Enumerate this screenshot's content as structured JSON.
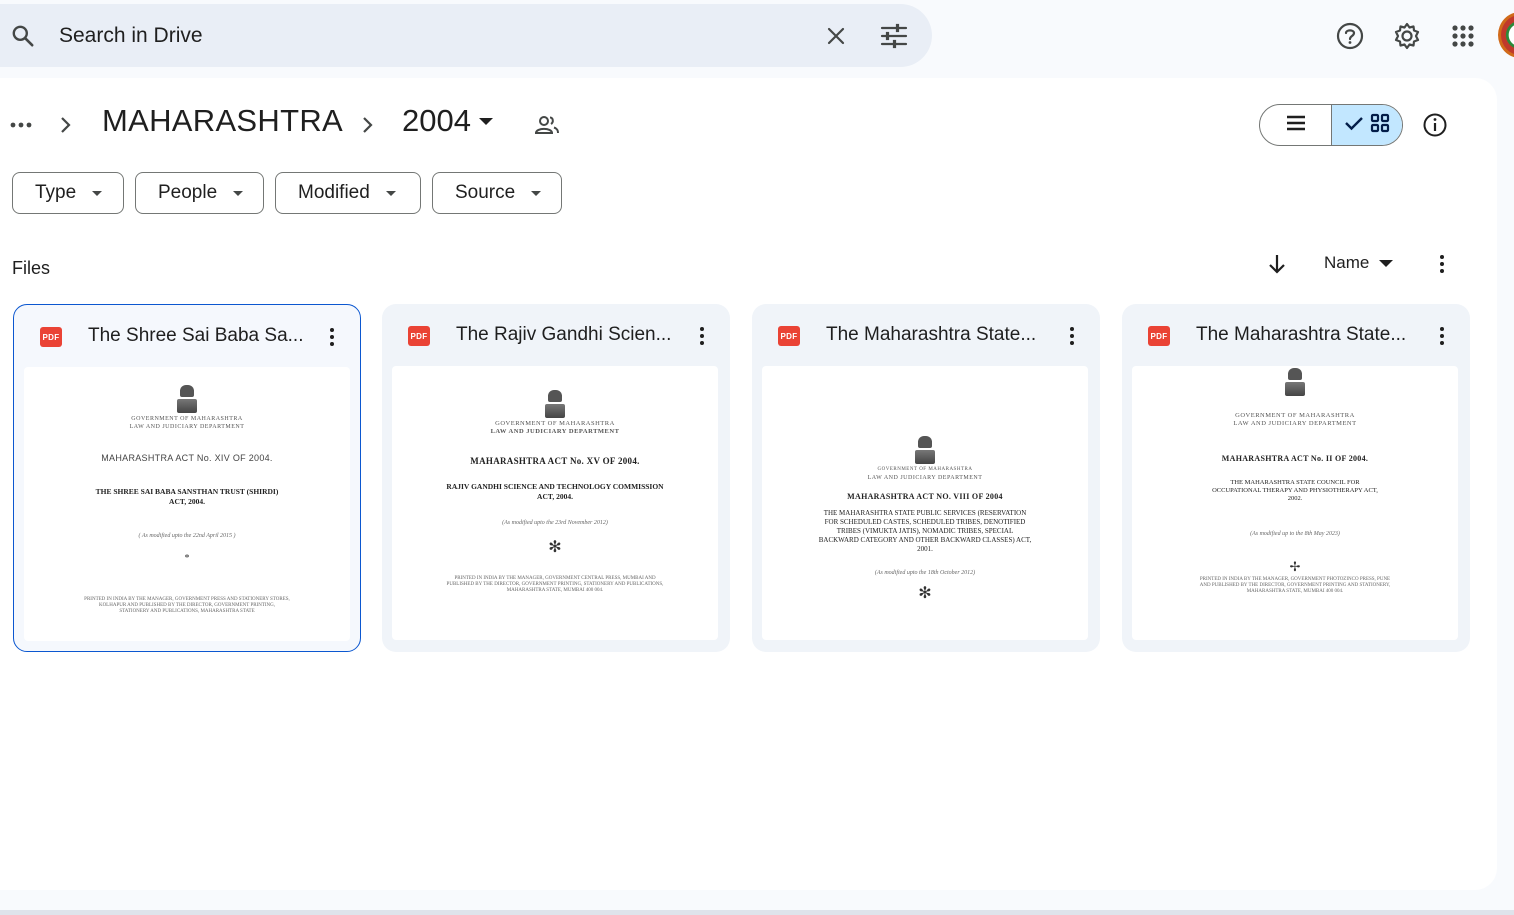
{
  "search": {
    "placeholder": "Search in Drive"
  },
  "breadcrumb": {
    "parent": "MAHARASHTRA",
    "current": "2004"
  },
  "filters": [
    "Type",
    "People",
    "Modified",
    "Source"
  ],
  "section": {
    "files_label": "Files",
    "sort_label": "Name"
  },
  "icons": {
    "search": "search-icon",
    "clear": "close-icon",
    "tune": "tune-icon",
    "help": "help-icon",
    "settings": "gear-icon",
    "apps": "apps-grid-icon",
    "shared": "people-icon",
    "list_view": "list-view-icon",
    "grid_view": "grid-view-icon",
    "check": "check-icon",
    "info": "info-icon",
    "sort": "arrow-down-icon",
    "more": "more-vert-icon"
  },
  "colors": {
    "accent": "#0b57d0",
    "pdf": "#ea4335",
    "toggle_active": "#c2e7ff"
  },
  "files": [
    {
      "title": "The Shree Sai Baba Sa...",
      "badge": "PDF",
      "preview": {
        "gov": "GOVERNMENT OF MAHARASHTRA",
        "dept": "LAW AND JUDICIARY DEPARTMENT",
        "act": "MAHARASHTRA ACT No. XIV OF 2004.",
        "name": "THE SHREE SAI BABA SANSTHAN TRUST (SHIRDI) ACT, 2004.",
        "modified": "( As modified upto the 22nd April 2015 )",
        "star": "*",
        "footer": "PRINTED IN INDIA BY THE MANAGER, GOVERNMENT PRESS AND STATIONERY STORES, KOLHAPUR AND PUBLISHED BY THE DIRECTOR, GOVERNMENT PRINTING, STATIONERY AND PUBLICATIONS, MAHARASHTRA STATE"
      }
    },
    {
      "title": "The Rajiv Gandhi Scien...",
      "badge": "PDF",
      "preview": {
        "gov": "GOVERNMENT OF MAHARASHTRA",
        "dept": "LAW AND JUDICIARY DEPARTMENT",
        "act": "MAHARASHTRA ACT No. XV OF 2004.",
        "name": "RAJIV GANDHI SCIENCE AND TECHNOLOGY COMMISSION ACT, 2004.",
        "modified": "(As modified upto the 23rd November 2012)",
        "star": "✻",
        "footer": "PRINTED IN INDIA BY THE MANAGER, GOVERNMENT CENTRAL PRESS, MUMBAI AND PUBLISHED BY THE DIRECTOR, GOVERNMENT PRINTING, STATIONERY AND PUBLICATIONS, MAHARASHTRA STATE, MUMBAI 400 004."
      }
    },
    {
      "title": "The Maharashtra State...",
      "badge": "PDF",
      "preview": {
        "gov": "GOVERNMENT OF MAHARASHTRA",
        "dept": "LAW AND JUDICIARY DEPARTMENT",
        "act": "MAHARASHTRA ACT NO. VIII OF 2004",
        "name": "THE MAHARASHTRA STATE PUBLIC SERVICES (RESERVATION FOR SCHEDULED CASTES, SCHEDULED TRIBES, DENOTIFIED TRIBES (VIMUKTA JATIS), NOMADIC TRIBES, SPECIAL BACKWARD CATEGORY AND OTHER BACKWARD CLASSES) ACT, 2001.",
        "modified": "(As modified upto the 18th October 2012)",
        "star": "✻",
        "footer": ""
      }
    },
    {
      "title": "The Maharashtra State...",
      "badge": "PDF",
      "preview": {
        "gov": "GOVERNMENT OF MAHARASHTRA",
        "dept": "LAW AND JUDICIARY DEPARTMENT",
        "act": "MAHARASHTRA ACT No. II OF 2004.",
        "name": "THE MAHARASHTRA STATE COUNCIL FOR OCCUPATIONAL THERAPY AND PHYSIOTHERAPY ACT, 2002.",
        "modified": "(As modified up to the 8th May 2023)",
        "star": "✢",
        "footer": "PRINTED IN INDIA BY THE MANAGER, GOVERNMENT PHOTOZINCO PRESS, PUNE AND PUBLISHED BY THE DIRECTOR, GOVERNMENT PRINTING AND STATIONERY, MAHARASHTRA STATE, MUMBAI 400 004."
      }
    }
  ]
}
